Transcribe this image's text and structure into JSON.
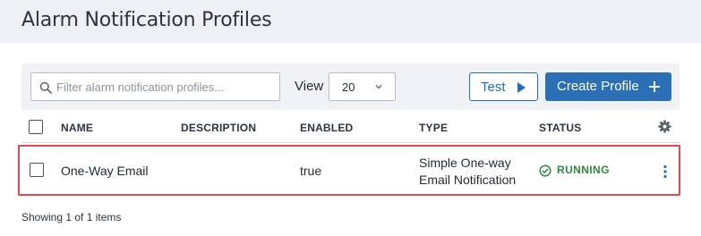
{
  "header": {
    "title": "Alarm Notification Profiles"
  },
  "toolbar": {
    "search_placeholder": "Filter alarm notification profiles...",
    "view_label": "View",
    "view_value": "20",
    "test_label": "Test",
    "create_label": "Create Profile"
  },
  "table": {
    "columns": [
      "NAME",
      "DESCRIPTION",
      "ENABLED",
      "TYPE",
      "STATUS"
    ],
    "rows": [
      {
        "name": "One-Way Email",
        "description": "",
        "enabled": "true",
        "type_line1": "Simple One-way",
        "type_line2": "Email Notification",
        "status": "RUNNING"
      }
    ]
  },
  "footer": {
    "summary": "Showing 1 of 1 items"
  },
  "colors": {
    "accent": "#2b6fb6",
    "status_running": "#2e8a3e",
    "highlight": "#e14a4f"
  },
  "icons": {
    "search": "search-icon",
    "chevron": "chevron-down-icon",
    "test": "play-icon",
    "create": "plus-icon",
    "settings": "gear-icon",
    "status": "check-circle-icon",
    "row_menu": "kebab-menu-icon"
  }
}
